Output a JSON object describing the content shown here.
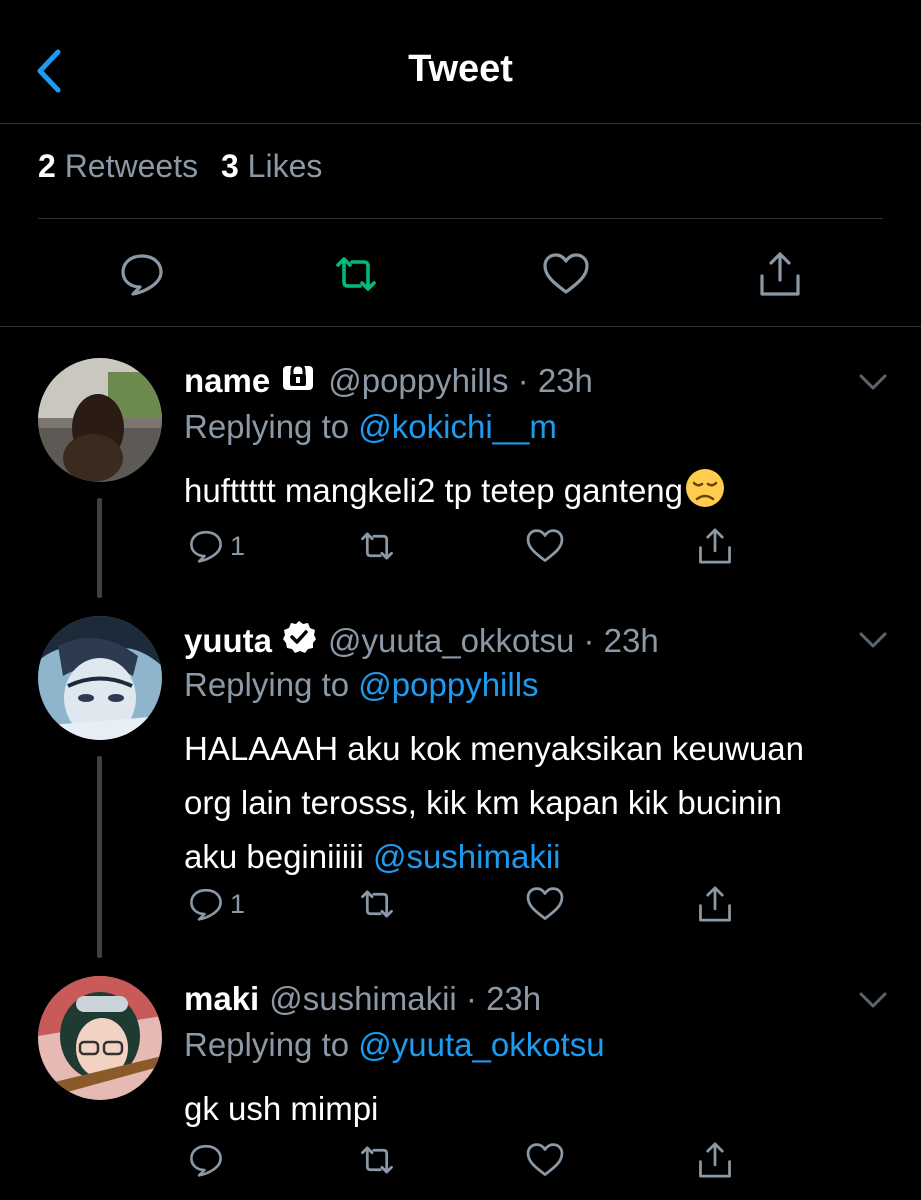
{
  "header": {
    "title": "Tweet",
    "back_icon": "chevron-left-icon"
  },
  "stats": {
    "retweets_count": "2",
    "retweets_label": "Retweets",
    "likes_count": "3",
    "likes_label": "Likes"
  },
  "colors": {
    "accent": "#1d9bf0",
    "retweet_active": "#00ba7c",
    "secondary_text": "#8b98a5",
    "divider": "#2f3336"
  },
  "replies": [
    {
      "name": "name",
      "badge": "lock-icon",
      "handle": "@poppyhills",
      "time": "23h",
      "replying_label": "Replying to",
      "replying_to": "@kokichi__m",
      "text": "hufttttt mangkeli2 tp tetep ganteng",
      "emoji": "disappointed-face-emoji",
      "reply_count": "1"
    },
    {
      "name": "yuuta",
      "badge": "verified-icon",
      "handle": "@yuuta_okkotsu",
      "time": "23h",
      "replying_label": "Replying to",
      "replying_to": "@poppyhills",
      "text_lines": [
        "HALAAAH aku kok menyaksikan keuwuan",
        "org lain terosss, kik km kapan kik bucinin",
        "aku beginiiiii "
      ],
      "text_mention": "@sushimakii",
      "reply_count": "1"
    },
    {
      "name": "maki",
      "handle": "@sushimakii",
      "time": "23h",
      "replying_label": "Replying to",
      "replying_to": "@yuuta_okkotsu",
      "text": "gk ush mimpi",
      "reply_count": ""
    }
  ]
}
